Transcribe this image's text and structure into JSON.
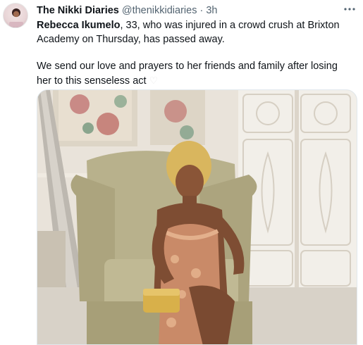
{
  "account": {
    "display_name": "The Nikki Diaries",
    "handle": "@thenikkidiaries",
    "separator": "·",
    "time": "3h"
  },
  "tweet": {
    "bold_name": "Rebecca Ikumelo",
    "line1_rest": ", 33, who was injured in a crowd crush at Brixton Academy on Thursday, has passed away.",
    "line2": "We send our love and prayers to her friends and family after losing her to this senseless act",
    "emoji": "♡"
  },
  "icons": {
    "more": "more-horizontal-icon",
    "avatar": "profile-avatar"
  }
}
